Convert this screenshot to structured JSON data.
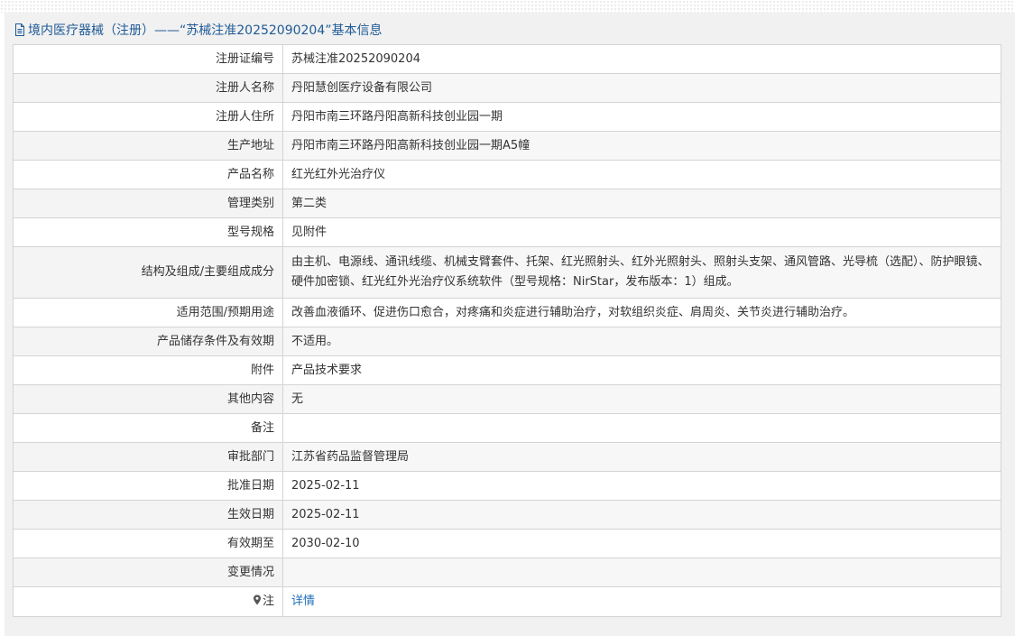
{
  "header": {
    "icon": "document-icon",
    "title": "境内医疗器械（注册）——“苏械注准20252090204”基本信息"
  },
  "rows": [
    {
      "label": "注册证编号",
      "value": "苏械注准20252090204"
    },
    {
      "label": "注册人名称",
      "value": "丹阳慧创医疗设备有限公司"
    },
    {
      "label": "注册人住所",
      "value": "丹阳市南三环路丹阳高新科技创业园一期"
    },
    {
      "label": "生产地址",
      "value": "丹阳市南三环路丹阳高新科技创业园一期A5幢"
    },
    {
      "label": "产品名称",
      "value": "红光红外光治疗仪"
    },
    {
      "label": "管理类别",
      "value": "第二类"
    },
    {
      "label": "型号规格",
      "value": "见附件"
    },
    {
      "label": "结构及组成/主要组成成分",
      "value": "由主机、电源线、通讯线缆、机械支臂套件、托架、红光照射头、红外光照射头、照射头支架、通风管路、光导梳（选配）、防护眼镜、硬件加密锁、红光红外光治疗仪系统软件（型号规格：NirStar，发布版本：1）组成。"
    },
    {
      "label": "适用范围/预期用途",
      "value": "改善血液循环、促进伤口愈合，对疼痛和炎症进行辅助治疗，对软组织炎症、肩周炎、关节炎进行辅助治疗。"
    },
    {
      "label": "产品储存条件及有效期",
      "value": "不适用。"
    },
    {
      "label": "附件",
      "value": "产品技术要求"
    },
    {
      "label": "其他内容",
      "value": "无"
    },
    {
      "label": "备注",
      "value": ""
    },
    {
      "label": "审批部门",
      "value": "江苏省药品监督管理局"
    },
    {
      "label": "批准日期",
      "value": "2025-02-11"
    },
    {
      "label": "生效日期",
      "value": "2025-02-11"
    },
    {
      "label": "有效期至",
      "value": "2030-02-10"
    },
    {
      "label": "变更情况",
      "value": ""
    }
  ],
  "note_row": {
    "icon": "pin-icon",
    "label": "注",
    "link_text": "详情"
  },
  "colors": {
    "header_text": "#1f5a96",
    "link": "#1f6fb8",
    "border": "#d4d4d4",
    "panel_bg": "#f1f1f1"
  }
}
